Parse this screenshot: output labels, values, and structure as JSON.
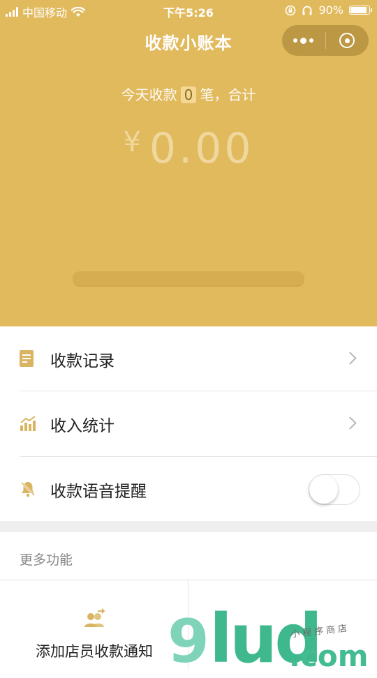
{
  "status_bar": {
    "carrier": "中国移动",
    "time": "下午5:26",
    "battery": "90%",
    "battery_fraction": 0.9
  },
  "nav": {
    "title": "收款小账本",
    "more_icon": "dots-icon",
    "close_icon": "target-icon"
  },
  "summary": {
    "prefix": "今天收款",
    "count": "0",
    "suffix": "笔，合计",
    "currency": "¥",
    "amount": "0.00"
  },
  "menu": {
    "records_label": "收款记录",
    "stats_label": "收入统计",
    "voice_label": "收款语音提醒",
    "voice_enabled": false
  },
  "more": {
    "section_label": "更多功能",
    "items": [
      {
        "label": "添加店员收款通知",
        "icon": "staff-add-icon"
      }
    ]
  },
  "watermark": {
    "brand_nine": "9",
    "brand_lud": "lud",
    "brand_com": ".com",
    "brand_sub": "小程序商店"
  },
  "colors": {
    "header_bg": "#E2BA5E",
    "accent": "#D9B563",
    "watermark_green": "#3FB88D"
  }
}
